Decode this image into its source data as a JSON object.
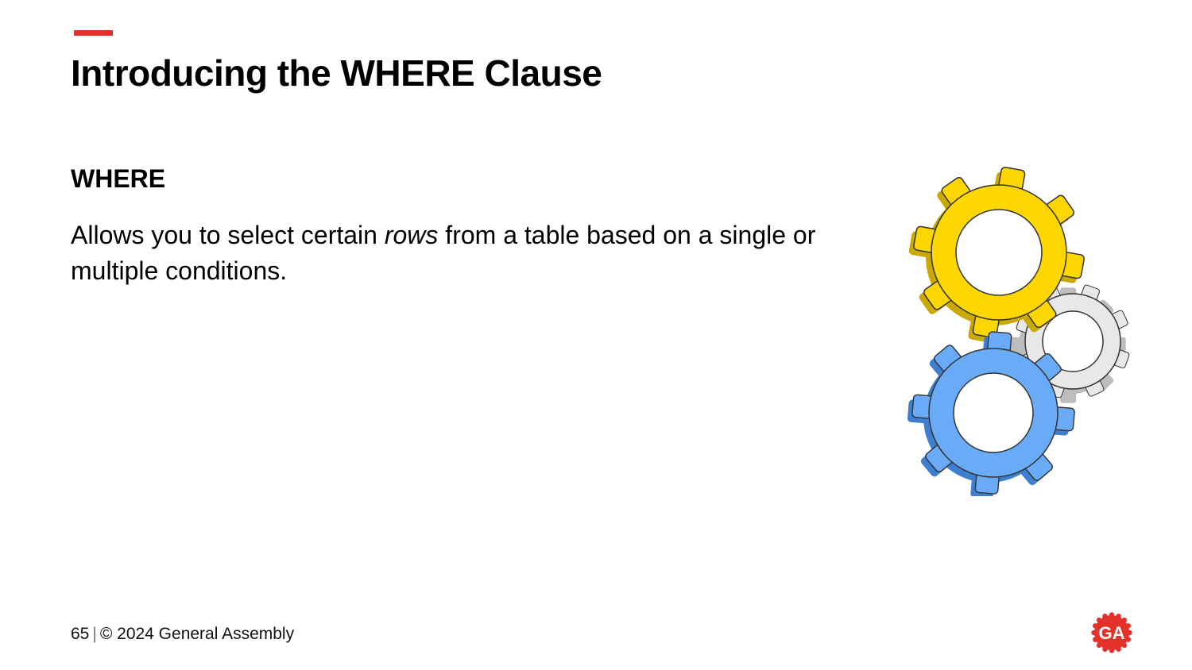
{
  "slide": {
    "title": "Introducing the WHERE Clause",
    "term": "WHERE",
    "description": {
      "before": "Allows you to select certain ",
      "emphasis": "rows",
      "after": " from a table based on a single or multiple conditions."
    }
  },
  "illustration": {
    "icon": "gears-icon",
    "colors": {
      "large_gear": "#ffd700",
      "small_gear": "#e8e8e8",
      "blue_gear": "#6aabf7"
    }
  },
  "footer": {
    "page_number": "65",
    "separator": "|",
    "copyright": "© 2024 General Assembly"
  },
  "logo": {
    "icon": "general-assembly-logo-icon",
    "text": "GA",
    "color": "#e4322b"
  },
  "colors": {
    "accent": "#e4322b"
  }
}
